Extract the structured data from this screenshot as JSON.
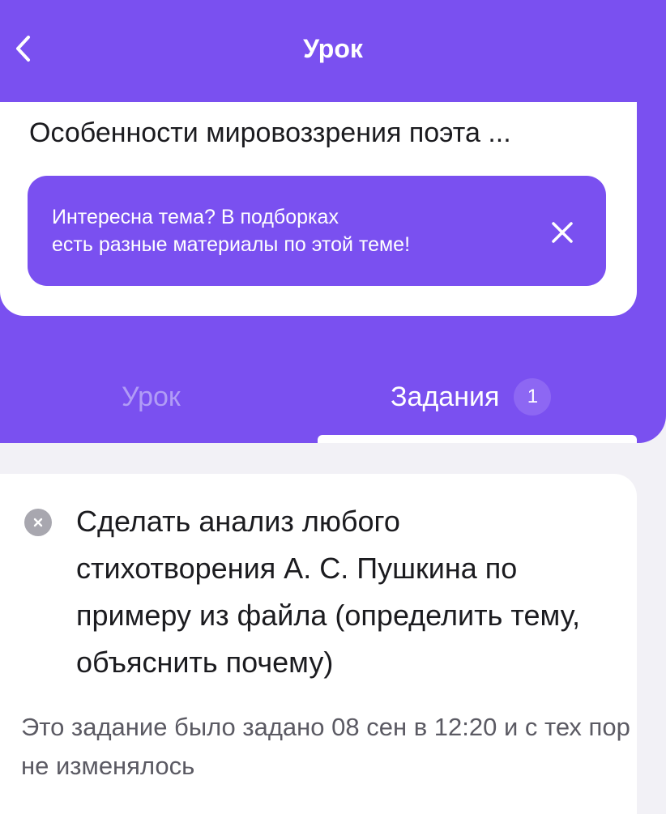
{
  "header": {
    "title": "Урок",
    "back_icon": "chevron-left-icon"
  },
  "lesson_card": {
    "title": "Особенности мировоззрения поэта ...",
    "banner": {
      "text": "Интересна тема? В подборках\nесть разные материалы по этой теме!",
      "close_icon": "close-icon"
    }
  },
  "tabs": [
    {
      "label": "Урок",
      "active": false
    },
    {
      "label": "Задания",
      "active": true,
      "badge": "1"
    }
  ],
  "task": {
    "status_icon": "close-circle-icon",
    "text": "Сделать анализ любого стихотворения А. С. Пушкина по примеру из файла (определить тему, объяснить почему)",
    "meta": "Это задание было задано 08 сен в 12:20 и с тех пор не изменялось"
  },
  "colors": {
    "accent": "#7a50f0",
    "background": "#f2f1f6",
    "inactive_tab": "#b19cf6",
    "status_gray": "#a8a7af"
  }
}
